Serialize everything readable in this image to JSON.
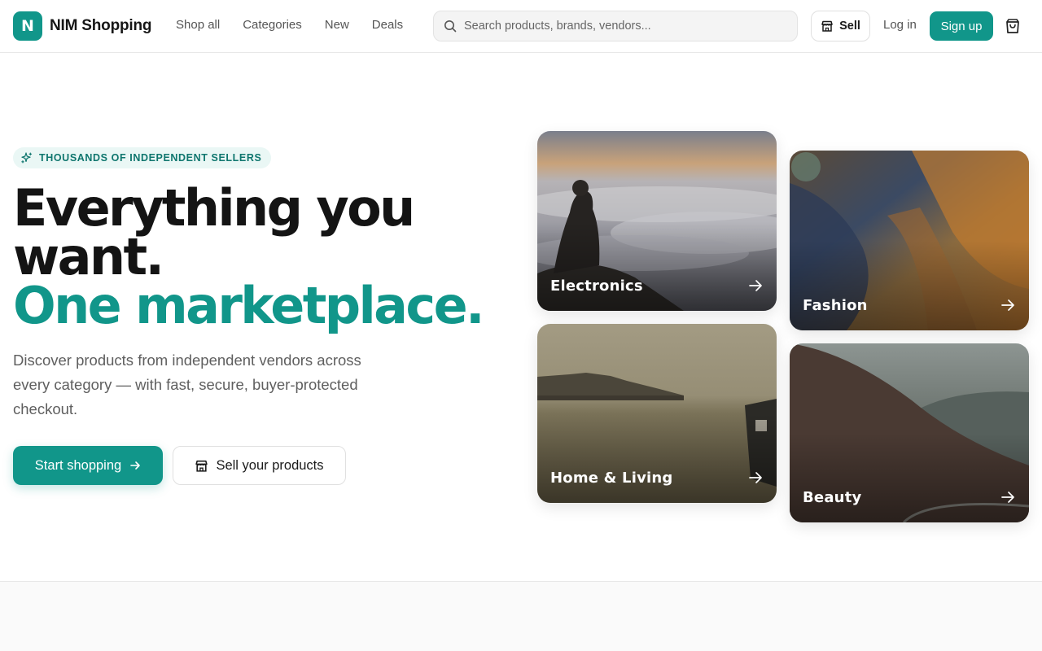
{
  "brand": {
    "mark": "N",
    "name": "NIM Shopping",
    "accent": "#11968a"
  },
  "nav": {
    "items": [
      {
        "label": "Shop all"
      },
      {
        "label": "Categories"
      },
      {
        "label": "New"
      },
      {
        "label": "Deals"
      }
    ]
  },
  "search": {
    "placeholder": "Search products, brands, vendors...",
    "value": "",
    "icon": "search-icon"
  },
  "header_actions": {
    "sell_label": "Sell",
    "login_label": "Log in",
    "signup_label": "Sign up",
    "cart_icon": "shopping-bag-icon"
  },
  "hero": {
    "badge": "THOUSANDS OF INDEPENDENT SELLERS",
    "headline_line1": "Everything you",
    "headline_line2": "want.",
    "headline_accent": "One marketplace.",
    "subtitle": "Discover products from independent vendors across every category — with fast, secure, buyer-protected checkout.",
    "primary_cta": "Start shopping",
    "secondary_cta": "Sell your products"
  },
  "categories": [
    {
      "label": "Electronics"
    },
    {
      "label": "Fashion"
    },
    {
      "label": "Home & Living"
    },
    {
      "label": "Beauty"
    }
  ],
  "colors": {
    "accent": "#11968a",
    "badge_bg": "#eaf7f5",
    "badge_text": "#0f766e",
    "headline": "#141414",
    "muted": "#5f5f5f"
  }
}
